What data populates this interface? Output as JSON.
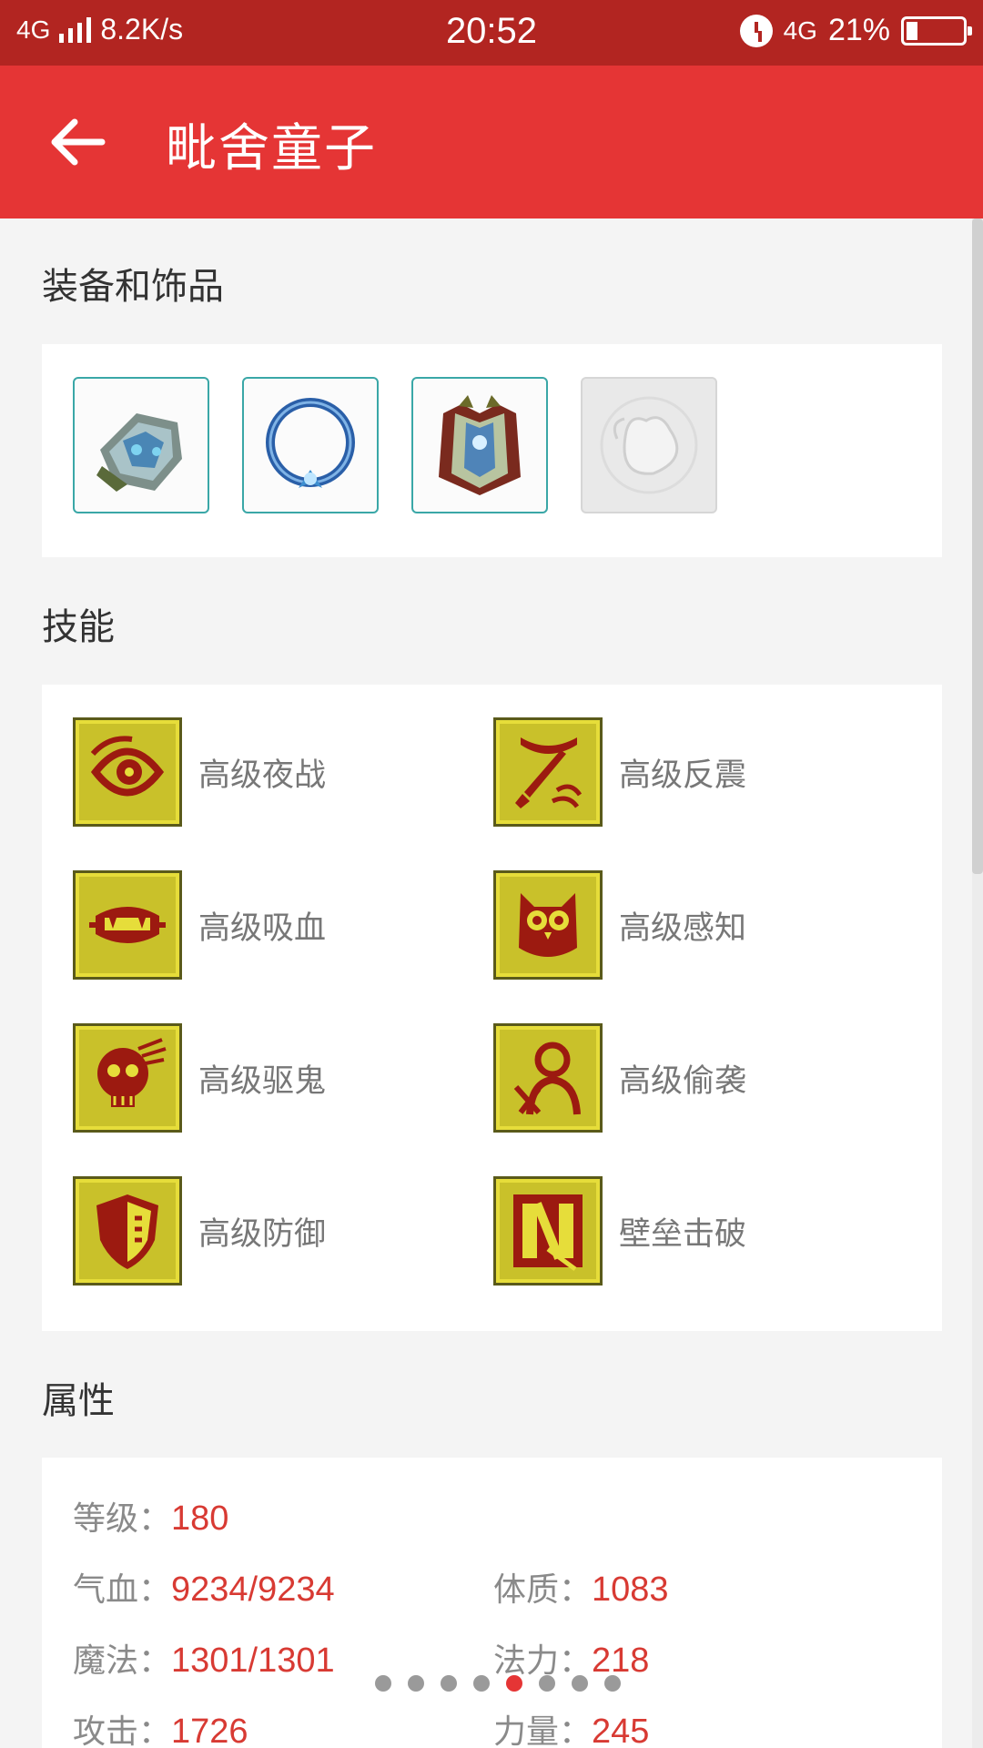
{
  "status_bar": {
    "network": "4G",
    "speed": "8.2K/s",
    "time": "20:52",
    "network_right": "4G",
    "battery": "21%"
  },
  "app_bar": {
    "title": "毗舍童子",
    "back_icon": "arrow-left-icon"
  },
  "equipment": {
    "heading": "装备和饰品",
    "items": [
      {
        "name": "gauntlet-icon"
      },
      {
        "name": "ring-icon"
      },
      {
        "name": "armor-icon"
      },
      {
        "name": "pouch-icon",
        "empty": true
      }
    ]
  },
  "skills": {
    "heading": "技能",
    "items": [
      {
        "label": "高级夜战",
        "icon": "eye-swirl-icon"
      },
      {
        "label": "高级反震",
        "icon": "sword-curve-icon"
      },
      {
        "label": "高级吸血",
        "icon": "fang-mouth-icon"
      },
      {
        "label": "高级感知",
        "icon": "owl-icon"
      },
      {
        "label": "高级驱鬼",
        "icon": "skull-icon"
      },
      {
        "label": "高级偷袭",
        "icon": "assassin-icon"
      },
      {
        "label": "高级防御",
        "icon": "shield-icon"
      },
      {
        "label": "壁垒击破",
        "icon": "wall-break-icon"
      }
    ]
  },
  "attributes": {
    "heading": "属性",
    "items": [
      {
        "key": "等级：",
        "value": "180"
      },
      {
        "key": "气血：",
        "value": "9234/9234"
      },
      {
        "key": "体质：",
        "value": "1083"
      },
      {
        "key": "魔法：",
        "value": "1301/1301"
      },
      {
        "key": "法力：",
        "value": "218"
      },
      {
        "key": "攻击：",
        "value": "1726"
      },
      {
        "key": "力量：",
        "value": "245"
      }
    ]
  },
  "pager": {
    "count": 8,
    "active_index": 4,
    "active_color": "#e53535"
  },
  "colors": {
    "status_bar": "#b22521",
    "app_bar": "#e53535",
    "value_red": "#d83a33"
  }
}
